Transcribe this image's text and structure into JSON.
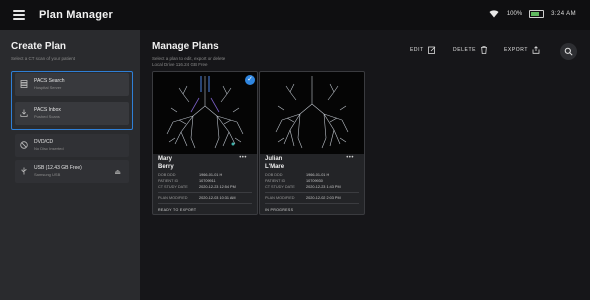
{
  "app": {
    "title": "Plan Manager",
    "status": {
      "battery_pct": "100%",
      "time": "3:24 AM"
    }
  },
  "sidebar": {
    "title": "Create Plan",
    "hint": "Select a CT scan of your patient",
    "sources": [
      {
        "title": "PACS Search",
        "subtitle": "Hospital Server",
        "icon": "server-icon"
      },
      {
        "title": "PACS Inbox",
        "subtitle": "Pushed Scans",
        "icon": "inbox-icon"
      },
      {
        "title": "DVD/CD",
        "subtitle": "No Disc Inserted",
        "icon": "disc-icon"
      },
      {
        "title": "USB (12.43 GB Free)",
        "subtitle": "Samsung USB",
        "icon": "usb-icon"
      }
    ]
  },
  "main": {
    "title": "Manage Plans",
    "subtitle": "Select a plan to edit, export or delete",
    "drive": "Local Drive 116.24 GB Free",
    "toolbar": {
      "edit": "EDIT",
      "delete": "DELETE",
      "export": "EXPORT"
    }
  },
  "plans": [
    {
      "first": "Mary",
      "last": "Berry",
      "dob_label": "DOB DDD",
      "dob": "1966-01-01 H",
      "patient_label": "PATIENT ID",
      "patient_id": "10709911",
      "study_label": "CT STUDY DATE",
      "study_date": "2020-12-23 12:54 PM",
      "modified_label": "PLAN MODIFIED",
      "modified": "2020-12-03 10:31 AM",
      "status": "READY TO EXPORT",
      "selected": true
    },
    {
      "first": "Julian",
      "last": "L'Mare",
      "dob_label": "DOB DDD",
      "dob": "1966-01-01 H",
      "patient_label": "PATIENT ID",
      "patient_id": "10709930",
      "study_label": "CT STUDY DATE",
      "study_date": "2020-12-23 1:43 PM",
      "modified_label": "PLAN MODIFIED",
      "modified": "2020-12-02 2:03 PM",
      "status": "IN PROGRESS",
      "selected": false
    }
  ],
  "colors": {
    "accent": "#2f86e0",
    "sidebar": "#2a2b2e",
    "background": "#161619"
  }
}
